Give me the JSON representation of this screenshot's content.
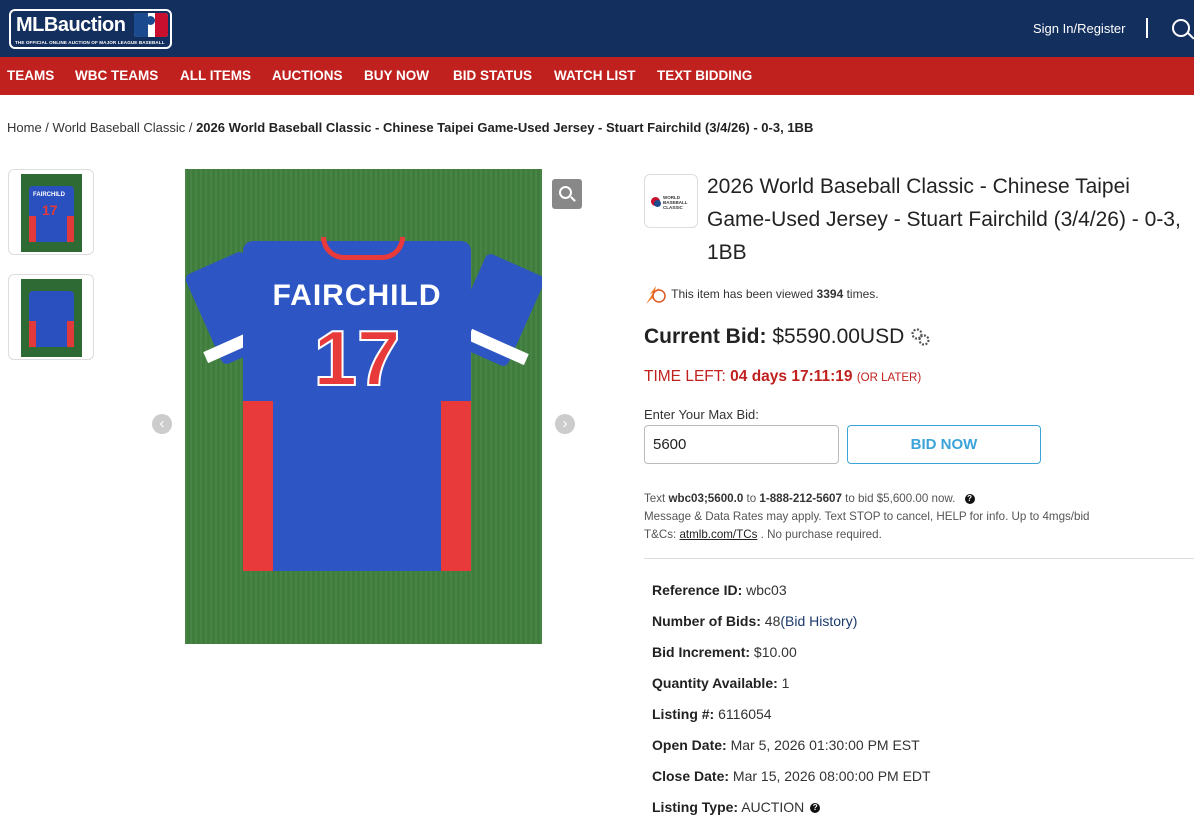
{
  "header": {
    "logo_text": "MLBauction",
    "logo_tagline": "THE OFFICIAL ONLINE AUCTION OF MAJOR LEAGUE BASEBALL",
    "signin_label": "Sign In/Register"
  },
  "nav": {
    "items": [
      "TEAMS",
      "WBC TEAMS",
      "ALL ITEMS",
      "AUCTIONS",
      "BUY NOW",
      "BID STATUS",
      "WATCH LIST",
      "TEXT BIDDING"
    ]
  },
  "breadcrumb": {
    "home": "Home",
    "category": "World Baseball Classic",
    "current": "2026 World Baseball Classic - Chinese Taipei Game-Used Jersey - Stuart Fairchild (3/4/26) - 0-3, 1BB"
  },
  "gallery": {
    "thumb_name": "FAIRCHILD",
    "thumb_number": "17",
    "jersey_name": "FAIRCHILD",
    "jersey_number": "17"
  },
  "product": {
    "logo_text": "WORLD BASEBALL CLASSIC",
    "title": "2026 World Baseball Classic - Chinese Taipei Game-Used Jersey - Stuart Fairchild (3/4/26) - 0-3, 1BB",
    "viewed_prefix": "This item has been viewed",
    "view_count": "3394",
    "viewed_suffix": "times.",
    "current_bid_label": "Current Bid:",
    "current_bid_value": "$5590.00USD",
    "time_left_label": "TIME LEFT:",
    "time_left_value": "04 days 17:11:19",
    "time_left_note": "(OR LATER)",
    "max_bid_label": "Enter Your Max Bid:",
    "max_bid_value": "5600",
    "bid_button": "BID NOW"
  },
  "text_bidding": {
    "text_word": "Text",
    "code": "wbc03;5600.0",
    "to_word": "to",
    "phone": "1-888-212-5607",
    "bid_text": "to bid $5,600.00 now.",
    "disclaimer": "Message & Data Rates may apply. Text STOP to cancel, HELP for info. Up to 4mgs/bid",
    "tcs_label": "T&Cs:",
    "tcs_link": "atmlb.com/TCs",
    "tcs_suffix": ". No purchase required."
  },
  "details": {
    "reference_id_label": "Reference ID:",
    "reference_id": "wbc03",
    "num_bids_label": "Number of Bids:",
    "num_bids": "48",
    "bid_history_link": "(Bid History)",
    "bid_increment_label": "Bid Increment:",
    "bid_increment": "$10.00",
    "quantity_label": "Quantity Available:",
    "quantity": "1",
    "listing_no_label": "Listing #:",
    "listing_no": "6116054",
    "open_date_label": "Open Date:",
    "open_date": "Mar 5, 2026 01:30:00 PM EST",
    "close_date_label": "Close Date:",
    "close_date": "Mar 15, 2026 08:00:00 PM EDT",
    "listing_type_label": "Listing Type:",
    "listing_type": "AUCTION"
  },
  "colors": {
    "header_bg": "#132f5e",
    "nav_bg": "#c0211f",
    "time_left": "#c0211f",
    "bid_button": "#3ba3d8"
  }
}
